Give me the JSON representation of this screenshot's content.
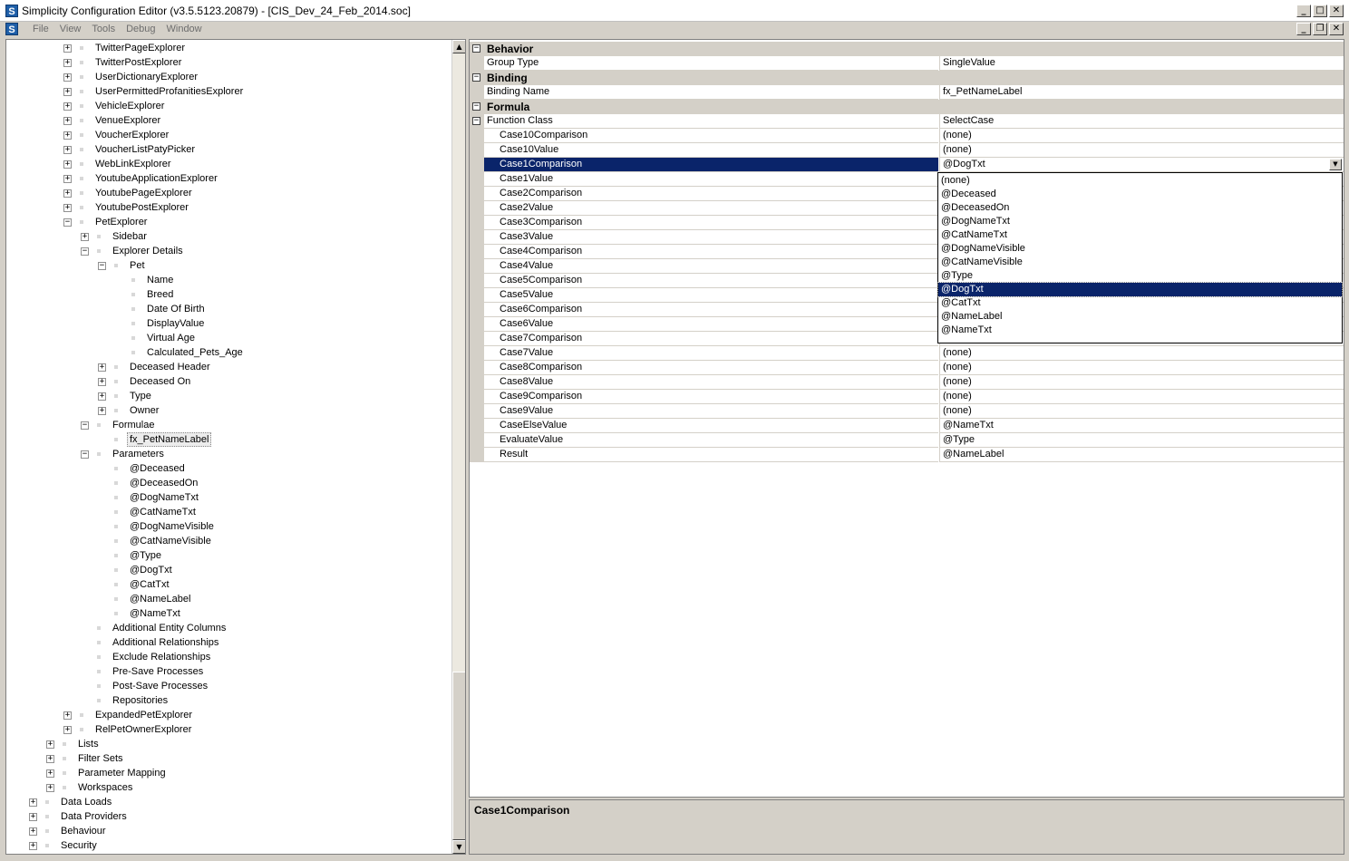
{
  "window": {
    "title": "Simplicity Configuration Editor (v3.5.5123.20879) - [CIS_Dev_24_Feb_2014.soc]",
    "app_icon_letter": "S",
    "buttons": {
      "minimize": "_",
      "maximize": "□",
      "close": "✕"
    },
    "mdi_buttons": {
      "minimize": "_",
      "restore": "❐",
      "close": "✕"
    }
  },
  "menu": {
    "items": [
      "File",
      "View",
      "Tools",
      "Debug",
      "Window"
    ]
  },
  "tree": {
    "scrollbar": {
      "up_arrow": "▲",
      "down_arrow": "▼"
    },
    "rows": [
      {
        "label": "TwitterPageExplorer",
        "level": 3,
        "expander": "plus"
      },
      {
        "label": "TwitterPostExplorer",
        "level": 3,
        "expander": "plus"
      },
      {
        "label": "UserDictionaryExplorer",
        "level": 3,
        "expander": "plus"
      },
      {
        "label": "UserPermittedProfanitiesExplorer",
        "level": 3,
        "expander": "plus"
      },
      {
        "label": "VehicleExplorer",
        "level": 3,
        "expander": "plus"
      },
      {
        "label": "VenueExplorer",
        "level": 3,
        "expander": "plus"
      },
      {
        "label": "VoucherExplorer",
        "level": 3,
        "expander": "plus"
      },
      {
        "label": "VoucherListPatyPicker",
        "level": 3,
        "expander": "plus"
      },
      {
        "label": "WebLinkExplorer",
        "level": 3,
        "expander": "plus"
      },
      {
        "label": "YoutubeApplicationExplorer",
        "level": 3,
        "expander": "plus"
      },
      {
        "label": "YoutubePageExplorer",
        "level": 3,
        "expander": "plus"
      },
      {
        "label": "YoutubePostExplorer",
        "level": 3,
        "expander": "plus"
      },
      {
        "label": "PetExplorer",
        "level": 3,
        "expander": "minus"
      },
      {
        "label": "Sidebar",
        "level": 4,
        "expander": "plus"
      },
      {
        "label": "Explorer Details",
        "level": 4,
        "expander": "minus"
      },
      {
        "label": "Pet",
        "level": 5,
        "expander": "minus"
      },
      {
        "label": "Name",
        "level": 6,
        "expander": "none"
      },
      {
        "label": "Breed",
        "level": 6,
        "expander": "none"
      },
      {
        "label": "Date Of Birth",
        "level": 6,
        "expander": "none"
      },
      {
        "label": "DisplayValue",
        "level": 6,
        "expander": "none"
      },
      {
        "label": "Virtual Age",
        "level": 6,
        "expander": "none"
      },
      {
        "label": "Calculated_Pets_Age",
        "level": 6,
        "expander": "none"
      },
      {
        "label": "Deceased Header",
        "level": 5,
        "expander": "plus"
      },
      {
        "label": "Deceased On",
        "level": 5,
        "expander": "plus"
      },
      {
        "label": "Type",
        "level": 5,
        "expander": "plus"
      },
      {
        "label": "Owner",
        "level": 5,
        "expander": "plus"
      },
      {
        "label": "Formulae",
        "level": 4,
        "expander": "minus"
      },
      {
        "label": "fx_PetNameLabel",
        "level": 5,
        "expander": "none",
        "selected": true
      },
      {
        "label": "Parameters",
        "level": 4,
        "expander": "minus"
      },
      {
        "label": "@Deceased",
        "level": 5,
        "expander": "none"
      },
      {
        "label": "@DeceasedOn",
        "level": 5,
        "expander": "none"
      },
      {
        "label": "@DogNameTxt",
        "level": 5,
        "expander": "none"
      },
      {
        "label": "@CatNameTxt",
        "level": 5,
        "expander": "none"
      },
      {
        "label": "@DogNameVisible",
        "level": 5,
        "expander": "none"
      },
      {
        "label": "@CatNameVisible",
        "level": 5,
        "expander": "none"
      },
      {
        "label": "@Type",
        "level": 5,
        "expander": "none"
      },
      {
        "label": "@DogTxt",
        "level": 5,
        "expander": "none"
      },
      {
        "label": "@CatTxt",
        "level": 5,
        "expander": "none"
      },
      {
        "label": "@NameLabel",
        "level": 5,
        "expander": "none"
      },
      {
        "label": "@NameTxt",
        "level": 5,
        "expander": "none"
      },
      {
        "label": "Additional Entity Columns",
        "level": 4,
        "expander": "none"
      },
      {
        "label": "Additional Relationships",
        "level": 4,
        "expander": "none"
      },
      {
        "label": "Exclude Relationships",
        "level": 4,
        "expander": "none"
      },
      {
        "label": "Pre-Save Processes",
        "level": 4,
        "expander": "none"
      },
      {
        "label": "Post-Save Processes",
        "level": 4,
        "expander": "none"
      },
      {
        "label": "Repositories",
        "level": 4,
        "expander": "none"
      },
      {
        "label": "ExpandedPetExplorer",
        "level": 3,
        "expander": "plus"
      },
      {
        "label": "RelPetOwnerExplorer",
        "level": 3,
        "expander": "plus"
      },
      {
        "label": "Lists",
        "level": 2,
        "expander": "plus"
      },
      {
        "label": "Filter Sets",
        "level": 2,
        "expander": "plus"
      },
      {
        "label": "Parameter Mapping",
        "level": 2,
        "expander": "plus"
      },
      {
        "label": "Workspaces",
        "level": 2,
        "expander": "plus"
      },
      {
        "label": "Data Loads",
        "level": 1,
        "expander": "plus"
      },
      {
        "label": "Data Providers",
        "level": 1,
        "expander": "plus"
      },
      {
        "label": "Behaviour",
        "level": 1,
        "expander": "plus"
      },
      {
        "label": "Security",
        "level": 1,
        "expander": "plus"
      }
    ]
  },
  "properties": {
    "rows": [
      {
        "kind": "category",
        "name": "Behavior"
      },
      {
        "kind": "prop",
        "name": "Group Type",
        "value": "SingleValue",
        "indent": false
      },
      {
        "kind": "category",
        "name": "Binding"
      },
      {
        "kind": "prop",
        "name": "Binding Name",
        "value": "fx_PetNameLabel",
        "indent": false
      },
      {
        "kind": "category",
        "name": "Formula"
      },
      {
        "kind": "prop",
        "name": "Function Class",
        "value": "SelectCase",
        "indent": false,
        "expander": "minus"
      },
      {
        "kind": "prop",
        "name": "Case10Comparison",
        "value": "(none)",
        "indent": true
      },
      {
        "kind": "prop",
        "name": "Case10Value",
        "value": "(none)",
        "indent": true
      },
      {
        "kind": "prop",
        "name": "Case1Comparison",
        "value": "@DogTxt",
        "indent": true,
        "selected": true
      },
      {
        "kind": "prop",
        "name": "Case1Value",
        "value": "",
        "indent": true
      },
      {
        "kind": "prop",
        "name": "Case2Comparison",
        "value": "",
        "indent": true
      },
      {
        "kind": "prop",
        "name": "Case2Value",
        "value": "",
        "indent": true
      },
      {
        "kind": "prop",
        "name": "Case3Comparison",
        "value": "",
        "indent": true
      },
      {
        "kind": "prop",
        "name": "Case3Value",
        "value": "",
        "indent": true
      },
      {
        "kind": "prop",
        "name": "Case4Comparison",
        "value": "",
        "indent": true
      },
      {
        "kind": "prop",
        "name": "Case4Value",
        "value": "",
        "indent": true
      },
      {
        "kind": "prop",
        "name": "Case5Comparison",
        "value": "",
        "indent": true
      },
      {
        "kind": "prop",
        "name": "Case5Value",
        "value": "",
        "indent": true
      },
      {
        "kind": "prop",
        "name": "Case6Comparison",
        "value": "",
        "indent": true
      },
      {
        "kind": "prop",
        "name": "Case6Value",
        "value": "",
        "indent": true
      },
      {
        "kind": "prop",
        "name": "Case7Comparison",
        "value": "",
        "indent": true
      },
      {
        "kind": "prop",
        "name": "Case7Value",
        "value": "(none)",
        "indent": true
      },
      {
        "kind": "prop",
        "name": "Case8Comparison",
        "value": "(none)",
        "indent": true
      },
      {
        "kind": "prop",
        "name": "Case8Value",
        "value": "(none)",
        "indent": true
      },
      {
        "kind": "prop",
        "name": "Case9Comparison",
        "value": "(none)",
        "indent": true
      },
      {
        "kind": "prop",
        "name": "Case9Value",
        "value": "(none)",
        "indent": true
      },
      {
        "kind": "prop",
        "name": "CaseElseValue",
        "value": "@NameTxt",
        "indent": true
      },
      {
        "kind": "prop",
        "name": "EvaluateValue",
        "value": "@Type",
        "indent": true
      },
      {
        "kind": "prop",
        "name": "Result",
        "value": "@NameLabel",
        "indent": true
      }
    ],
    "dropdown_arrow": "▼",
    "dropdown": {
      "selected": "@DogTxt",
      "options": [
        "(none)",
        "@Deceased",
        "@DeceasedOn",
        "@DogNameTxt",
        "@CatNameTxt",
        "@DogNameVisible",
        "@CatNameVisible",
        "@Type",
        "@DogTxt",
        "@CatTxt",
        "@NameLabel",
        "@NameTxt"
      ]
    }
  },
  "description": {
    "title": "Case1Comparison"
  },
  "colors": {
    "selection": "#0a246a",
    "panel_bg": "#d4d0c8"
  }
}
